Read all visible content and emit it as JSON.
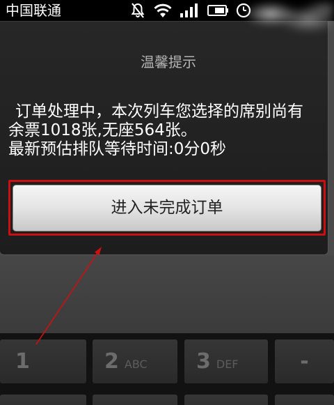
{
  "status_bar": {
    "carrier": "中国联通",
    "icons": [
      "mute-icon",
      "wifi-icon",
      "signal-icon",
      "battery-icon",
      "alarm-clock-icon"
    ]
  },
  "dialog": {
    "title": "温馨提示",
    "message": [
      "订单处理中，本次列车您选择的席别尚有",
      "余票1018张,无座564张。",
      "最新预估排队等待时间:0分0秒"
    ],
    "button_label": "进入未完成订单"
  },
  "keypad": {
    "keys": [
      {
        "digit": "1"
      },
      {
        "digit": "2",
        "letters": "ABC"
      },
      {
        "digit": "3",
        "letters": "DEF"
      },
      {
        "digit": "-"
      }
    ]
  },
  "colors": {
    "annotation_red": "#cc1010",
    "dialog_background": "#1d1d1d",
    "dialog_title": "#b4b4b4",
    "message_text": "#ffffff",
    "button_text": "#222222"
  }
}
